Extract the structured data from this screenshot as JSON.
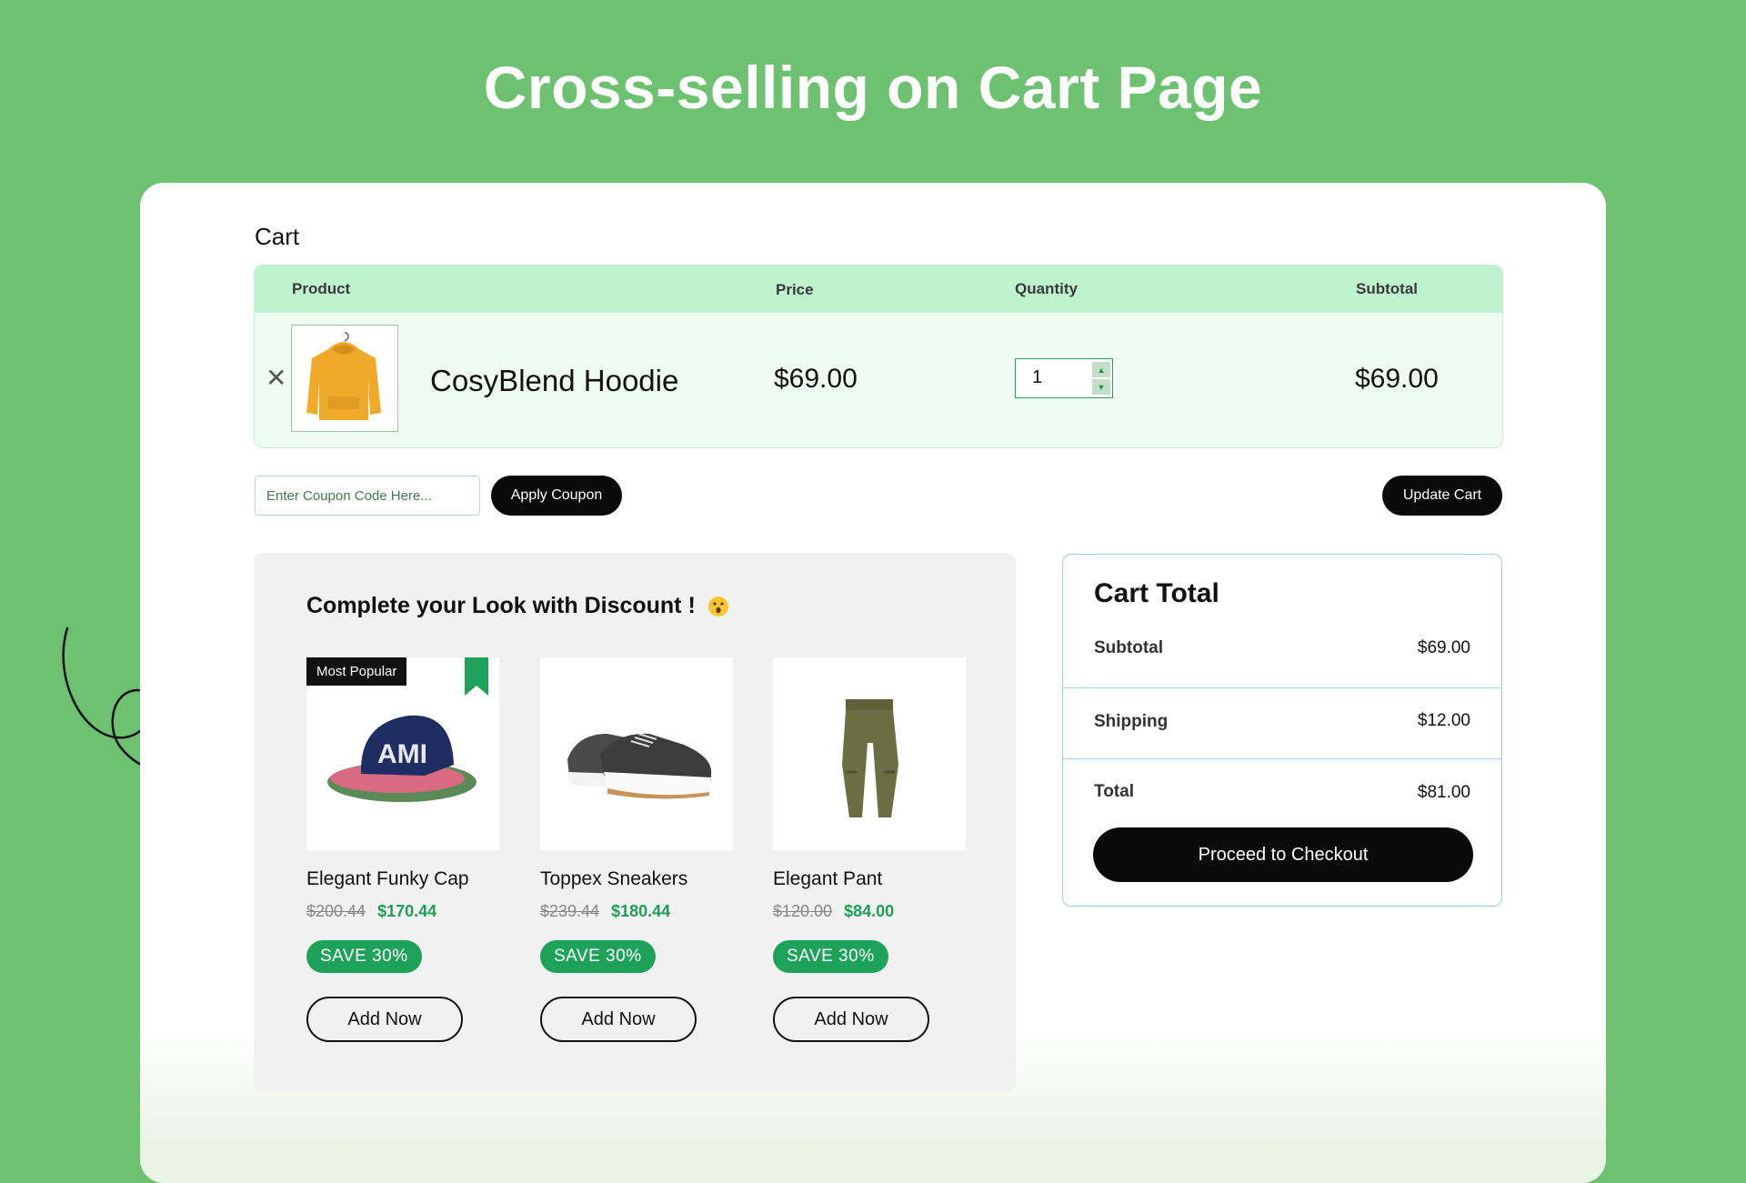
{
  "page": {
    "title": "Cross-selling on Cart Page"
  },
  "cart": {
    "title": "Cart",
    "columns": {
      "product": "Product",
      "price": "Price",
      "quantity": "Quantity",
      "subtotal": "Subtotal"
    },
    "item": {
      "name": "CosyBlend Hoodie",
      "price": "$69.00",
      "quantity": "1",
      "subtotal": "$69.00"
    }
  },
  "coupon": {
    "placeholder": "Enter Coupon Code Here...",
    "apply_label": "Apply Coupon"
  },
  "update_cart_label": "Update Cart",
  "cross_sell": {
    "title": "Complete your Look with Discount !",
    "badge": "Most Popular",
    "products": [
      {
        "name": "Elegant Funky Cap",
        "old_price": "$200.44",
        "new_price": "$170.44",
        "save": "SAVE 30%",
        "add_label": "Add Now"
      },
      {
        "name": "Toppex Sneakers",
        "old_price": "$239.44",
        "new_price": "$180.44",
        "save": "SAVE 30%",
        "add_label": "Add Now"
      },
      {
        "name": "Elegant Pant",
        "old_price": "$120.00",
        "new_price": "$84.00",
        "save": "SAVE 30%",
        "add_label": "Add Now"
      }
    ]
  },
  "cart_total": {
    "title": "Cart Total",
    "subtotal_label": "Subtotal",
    "subtotal": "$69.00",
    "shipping_label": "Shipping",
    "shipping": "$12.00",
    "total_label": "Total",
    "total": "$81.00",
    "checkout_label": "Proceed to Checkout"
  },
  "colors": {
    "background": "#6dc170",
    "accent": "#1ea25a",
    "header": "#bff3cf"
  }
}
